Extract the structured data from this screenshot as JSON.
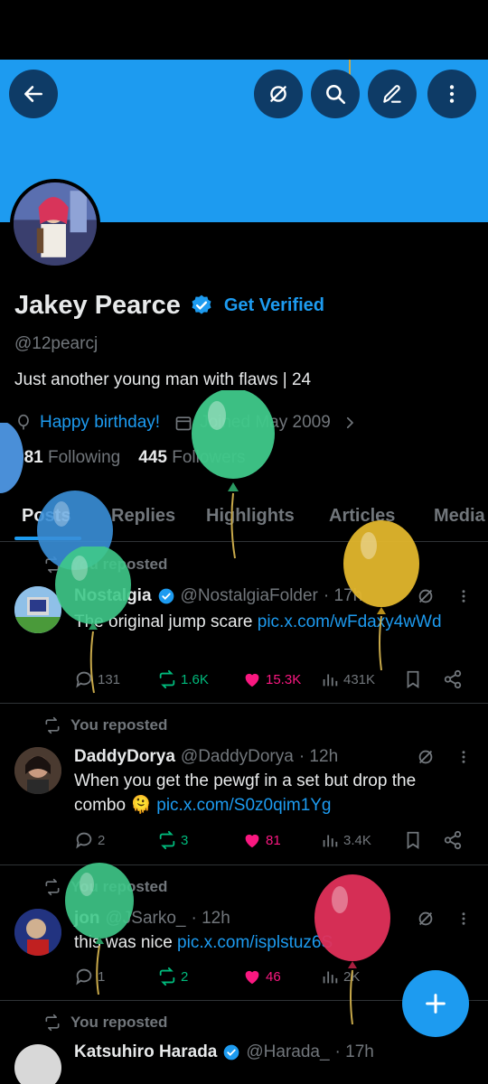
{
  "header": {
    "icons": [
      "back-arrow-icon",
      "grok-icon",
      "search-icon",
      "edit-icon",
      "more-vertical-icon"
    ]
  },
  "profile": {
    "name": "Jakey Pearce",
    "get_verified": "Get Verified",
    "handle": "@12pearcj",
    "bio": "Just another young man with flaws | 24",
    "birthday": "Happy birthday!",
    "joined": "Joined May 2009",
    "following_count": "981",
    "following_label": "Following",
    "followers_count": "445",
    "followers_label": "Followers"
  },
  "tabs": [
    {
      "label": "Posts"
    },
    {
      "label": "Replies"
    },
    {
      "label": "Highlights"
    },
    {
      "label": "Articles"
    },
    {
      "label": "Media"
    }
  ],
  "posts": [
    {
      "repost_label": "You reposted",
      "name": "Nostalgia",
      "handle": "@NostalgiaFolder",
      "time": "· 17h",
      "text": "The original jump scare ",
      "link": "pic.x.com/wFdaxy4wWd",
      "replies": "131",
      "reposts": "1.6K",
      "likes": "15.3K",
      "views": "431K"
    },
    {
      "repost_label": "You reposted",
      "name": "DaddyDorya",
      "handle": "@DaddyDorya",
      "time": "· 12h",
      "text": "When you get the pewgf in a set but drop the combo 🫠 ",
      "link": "pic.x.com/S0z0qim1Yg",
      "replies": "2",
      "reposts": "3",
      "likes": "81",
      "views": "3.4K"
    },
    {
      "repost_label": "You reposted",
      "name": "jon",
      "handle": "@JSarko_",
      "time": "· 12h",
      "text": "this was nice ",
      "link": "pic.x.com/isplstuz6S",
      "replies": "1",
      "reposts": "2",
      "likes": "46",
      "views": "2K"
    },
    {
      "repost_label": "You reposted",
      "name": "Katsuhiro Harada",
      "handle": "@Harada_",
      "time": "· 17h"
    }
  ],
  "colors": {
    "accent": "#1d9bf0",
    "repost": "#00ba7c",
    "like": "#f91880",
    "banner": "#1d9bf0"
  }
}
